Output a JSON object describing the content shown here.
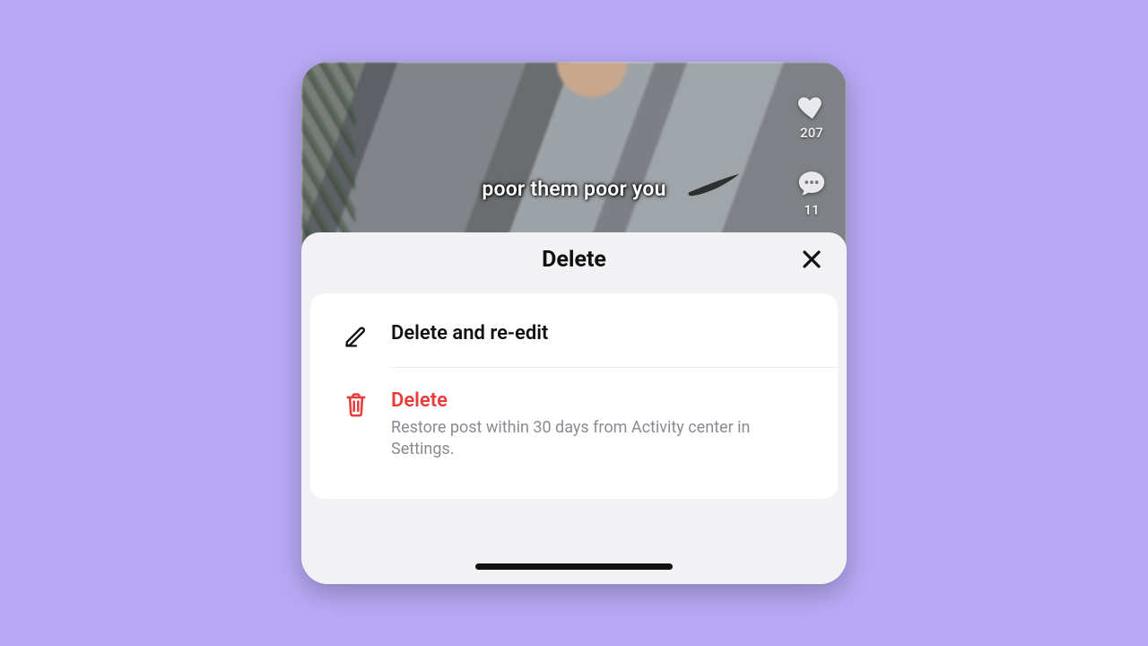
{
  "video": {
    "caption": "poor them poor you",
    "like_count": "207",
    "comment_count": "11"
  },
  "sheet": {
    "title": "Delete",
    "options": {
      "reedit": {
        "label": "Delete and re-edit"
      },
      "delete": {
        "label": "Delete",
        "subtitle": "Restore post within 30 days from Activity center in Settings."
      }
    }
  }
}
